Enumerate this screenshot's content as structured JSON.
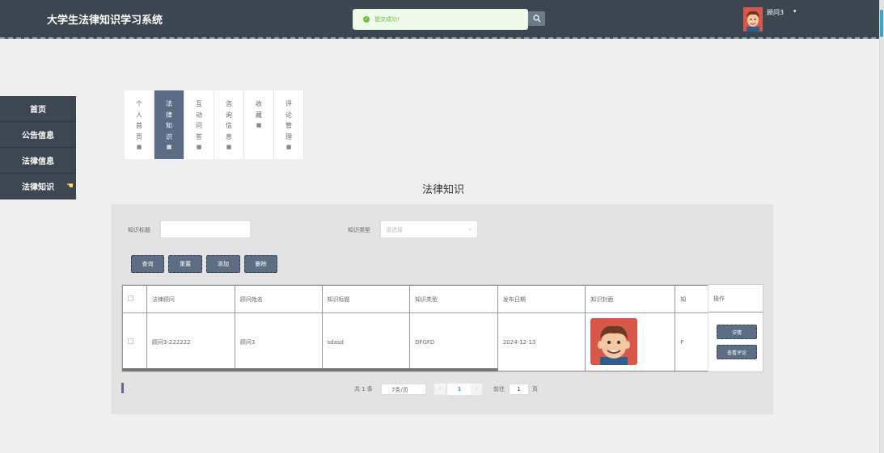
{
  "app": {
    "title": "大学生法律知识学习系统"
  },
  "toast": {
    "message": "提交成功!"
  },
  "user": {
    "name": "顾问3"
  },
  "sidebar": {
    "items": [
      {
        "label": "首页"
      },
      {
        "label": "公告信息"
      },
      {
        "label": "法律信息"
      },
      {
        "label": "法律知识"
      }
    ]
  },
  "tabs": [
    {
      "label": "个人首页",
      "active": false
    },
    {
      "label": "法律知识",
      "active": true
    },
    {
      "label": "互动问答",
      "active": false
    },
    {
      "label": "咨询信息",
      "active": false
    },
    {
      "label": "收藏",
      "active": false
    },
    {
      "label": "评论管理",
      "active": false
    }
  ],
  "page": {
    "title": "法律知识"
  },
  "filters": {
    "title_label": "知识标题",
    "title_value": "",
    "type_label": "知识类型",
    "type_placeholder": "请选择"
  },
  "actions": {
    "query": "查询",
    "reset": "重置",
    "add": "添加",
    "delete": "删除"
  },
  "table": {
    "columns": [
      "法律顾问",
      "顾问姓名",
      "知识标题",
      "知识类型",
      "发布日期",
      "知识封面",
      "知"
    ],
    "op_header": "操作",
    "rows": [
      {
        "advisor": "顾问3-222222",
        "name": "顾问3",
        "title": "sdasd",
        "type": "DFGFD",
        "date": "2024-12-13",
        "extra": "F"
      }
    ],
    "row_actions": {
      "detail": "详情",
      "comments": "查看评论"
    }
  },
  "pagination": {
    "total": "共 1 条",
    "page_size": "7条/页",
    "current": "1",
    "goto_prefix": "前往",
    "goto_value": "1",
    "goto_suffix": "页"
  },
  "colors": {
    "topbar": "#3b4651",
    "accent": "#5d6d83",
    "success": "#67c23a"
  }
}
